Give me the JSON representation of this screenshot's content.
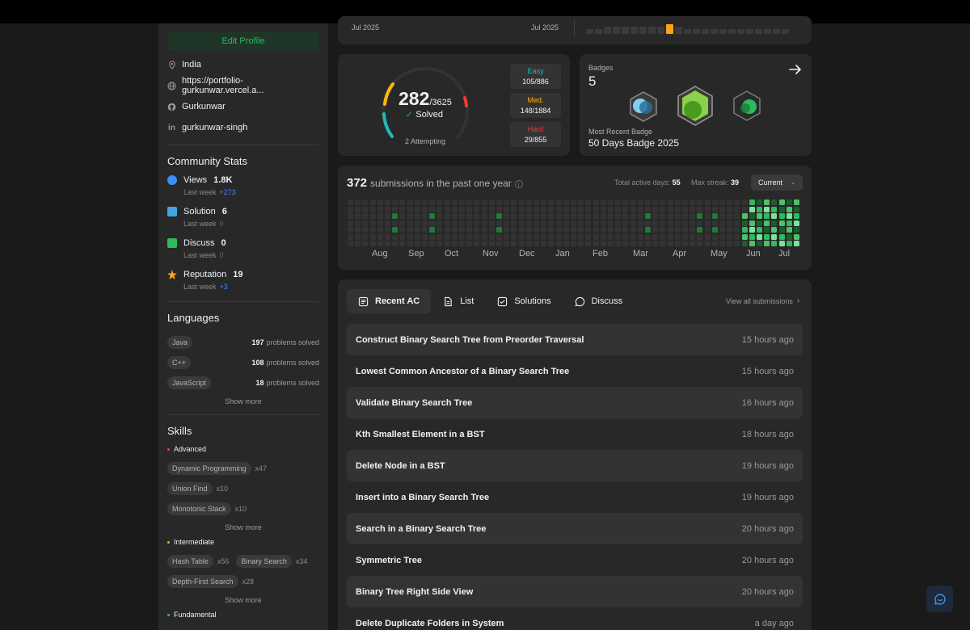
{
  "sidebar": {
    "edit_profile": "Edit Profile",
    "location": "India",
    "website": "https://portfolio-gurkunwar.vercel.a...",
    "github": "Gurkunwar",
    "linkedin": "gurkunwar-singh",
    "community_title": "Community Stats",
    "stats": [
      {
        "label": "Views",
        "value": "1.8K",
        "sub": "Last week",
        "delta": "+273",
        "color": "#3e8ef7"
      },
      {
        "label": "Solution",
        "value": "6",
        "sub": "Last week",
        "delta": "0",
        "color": "#3ea6e0"
      },
      {
        "label": "Discuss",
        "value": "0",
        "sub": "Last week",
        "delta": "0",
        "color": "#2cbb5d"
      },
      {
        "label": "Reputation",
        "value": "19",
        "sub": "Last week",
        "delta": "+3",
        "color": "#ffa116"
      }
    ],
    "languages_title": "Languages",
    "languages": [
      {
        "name": "Java",
        "count": "197",
        "suffix": "problems solved"
      },
      {
        "name": "C++",
        "count": "108",
        "suffix": "problems solved"
      },
      {
        "name": "JavaScript",
        "count": "18",
        "suffix": "problems solved"
      }
    ],
    "show_more": "Show more",
    "skills_title": "Skills",
    "advanced_label": "Advanced",
    "advanced": [
      {
        "name": "Dynamic Programming",
        "count": "x47"
      },
      {
        "name": "Union Find",
        "count": "x10"
      },
      {
        "name": "Monotonic Stack",
        "count": "x10"
      }
    ],
    "intermediate_label": "Intermediate",
    "intermediate": [
      {
        "name": "Hash Table",
        "count": "x56"
      },
      {
        "name": "Binary Search",
        "count": "x34"
      },
      {
        "name": "Depth-First Search",
        "count": "x28"
      }
    ],
    "fundamental_label": "Fundamental"
  },
  "contest_top": {
    "left_date": "Jul 2025",
    "right_date": "Jul 2025"
  },
  "solved": {
    "count": "282",
    "total": "/3625",
    "solved_label": "Solved",
    "attempting": "2 Attempting",
    "easy_label": "Easy",
    "easy_count": "105/886",
    "med_label": "Med.",
    "med_count": "148/1884",
    "hard_label": "Hard",
    "hard_count": "29/855",
    "colors": {
      "easy": "#1cbaba",
      "med": "#ffb700",
      "hard": "#f63737"
    }
  },
  "badges": {
    "title": "Badges",
    "count": "5",
    "recent_label": "Most Recent Badge",
    "recent_name": "50 Days Badge 2025"
  },
  "heatmap": {
    "count": "372",
    "label": "submissions in the past one year",
    "active_label": "Total active days:",
    "active_value": "55",
    "streak_label": "Max streak:",
    "streak_value": "39",
    "dropdown": "Current",
    "months": [
      "Aug",
      "Sep",
      "Oct",
      "Nov",
      "Dec",
      "Jan",
      "Feb",
      "Mar",
      "Apr",
      "May",
      "Jun",
      "Jul"
    ]
  },
  "tabs": [
    {
      "label": "Recent AC",
      "icon": "checklist-icon"
    },
    {
      "label": "List",
      "icon": "document-icon"
    },
    {
      "label": "Solutions",
      "icon": "solution-icon"
    },
    {
      "label": "Discuss",
      "icon": "discuss-icon"
    }
  ],
  "view_all": "View all submissions",
  "submissions": [
    {
      "title": "Construct Binary Search Tree from Preorder Traversal",
      "time": "15 hours ago"
    },
    {
      "title": "Lowest Common Ancestor of a Binary Search Tree",
      "time": "15 hours ago"
    },
    {
      "title": "Validate Binary Search Tree",
      "time": "16 hours ago"
    },
    {
      "title": "Kth Smallest Element in a BST",
      "time": "18 hours ago"
    },
    {
      "title": "Delete Node in a BST",
      "time": "19 hours ago"
    },
    {
      "title": "Insert into a Binary Search Tree",
      "time": "19 hours ago"
    },
    {
      "title": "Search in a Binary Search Tree",
      "time": "20 hours ago"
    },
    {
      "title": "Symmetric Tree",
      "time": "20 hours ago"
    },
    {
      "title": "Binary Tree Right Side View",
      "time": "20 hours ago"
    },
    {
      "title": "Delete Duplicate Folders in System",
      "time": "a day ago"
    }
  ]
}
